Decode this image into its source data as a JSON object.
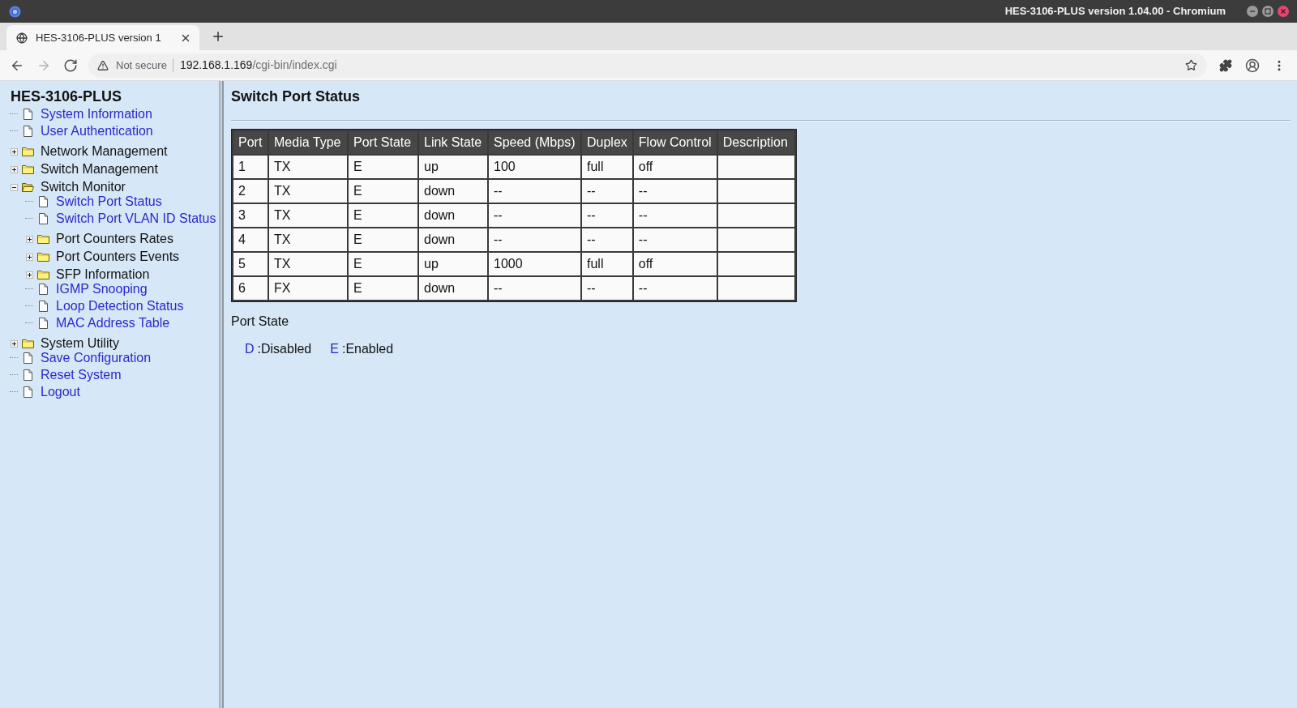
{
  "window": {
    "title": "HES-3106-PLUS version 1.04.00 - Chromium"
  },
  "browser": {
    "tabs": [
      {
        "title": "HES-3106-PLUS version 1",
        "selected": true
      }
    ],
    "nav": [
      {
        "kind": "back",
        "disabled": false
      },
      {
        "kind": "forward",
        "disabled": true
      },
      {
        "kind": "reload",
        "disabled": false
      }
    ],
    "security": "Not secure",
    "url": {
      "host": "192.168.1.169",
      "path": "/cgi-bin/index.cgi"
    }
  },
  "sidebar": {
    "title": "HES-3106-PLUS",
    "items": [
      {
        "kind": "page",
        "label": "System Information"
      },
      {
        "kind": "page",
        "label": "User Authentication"
      },
      {
        "kind": "folder",
        "label": "Network Management",
        "expanded": false
      },
      {
        "kind": "folder",
        "label": "Switch Management",
        "expanded": false
      },
      {
        "kind": "folder",
        "label": "Switch Monitor",
        "expanded": true,
        "children": [
          {
            "kind": "page",
            "label": "Switch Port Status"
          },
          {
            "kind": "page",
            "label": "Switch Port VLAN ID Status"
          },
          {
            "kind": "folder",
            "label": "Port Counters Rates",
            "expanded": false
          },
          {
            "kind": "folder",
            "label": "Port Counters Events",
            "expanded": false
          },
          {
            "kind": "folder",
            "label": "SFP Information",
            "expanded": false
          },
          {
            "kind": "page",
            "label": "IGMP Snooping"
          },
          {
            "kind": "page",
            "label": "Loop Detection Status"
          },
          {
            "kind": "page",
            "label": "MAC Address Table"
          }
        ]
      },
      {
        "kind": "folder",
        "label": "System Utility",
        "expanded": false
      },
      {
        "kind": "page",
        "label": "Save Configuration"
      },
      {
        "kind": "page",
        "label": "Reset System"
      },
      {
        "kind": "page",
        "label": "Logout"
      }
    ]
  },
  "content": {
    "heading": "Switch Port Status",
    "table": {
      "columns": [
        "Port",
        "Media Type",
        "Port State",
        "Link State",
        "Speed (Mbps)",
        "Duplex",
        "Flow Control",
        "Description"
      ],
      "rows": [
        [
          "1",
          "TX",
          "E",
          "up",
          "100",
          "full",
          "off"
        ],
        [
          "2",
          "TX",
          "E",
          "down",
          "--",
          "--",
          "--"
        ],
        [
          "3",
          "TX",
          "E",
          "down",
          "--",
          "--",
          "--"
        ],
        [
          "4",
          "TX",
          "E",
          "down",
          "--",
          "--",
          "--"
        ],
        [
          "5",
          "TX",
          "E",
          "up",
          "1000",
          "full",
          "off"
        ],
        [
          "6",
          "FX",
          "E",
          "down",
          "--",
          "--",
          "--"
        ]
      ]
    },
    "legend": {
      "title": "Port State",
      "entries": [
        {
          "code": "D",
          "label": ":Disabled"
        },
        {
          "code": "E",
          "label": ":Enabled"
        }
      ]
    }
  }
}
